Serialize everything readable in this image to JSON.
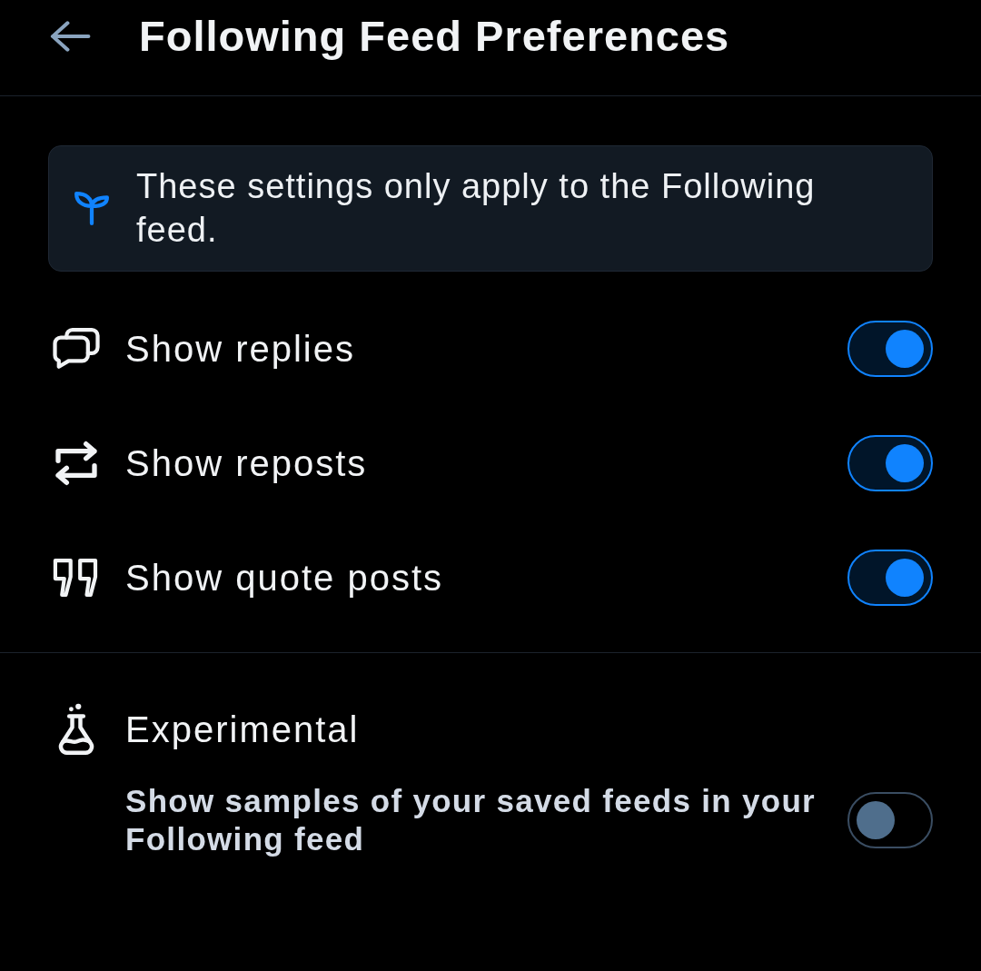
{
  "header": {
    "title": "Following Feed Preferences"
  },
  "notice": {
    "text": "These settings only apply to the Following feed."
  },
  "settings": [
    {
      "label": "Show replies",
      "on": true
    },
    {
      "label": "Show reposts",
      "on": true
    },
    {
      "label": "Show quote posts",
      "on": true
    }
  ],
  "experimental": {
    "title": "Experimental",
    "settings": [
      {
        "label": "Show samples of your saved feeds in your Following feed",
        "on": false
      }
    ]
  }
}
